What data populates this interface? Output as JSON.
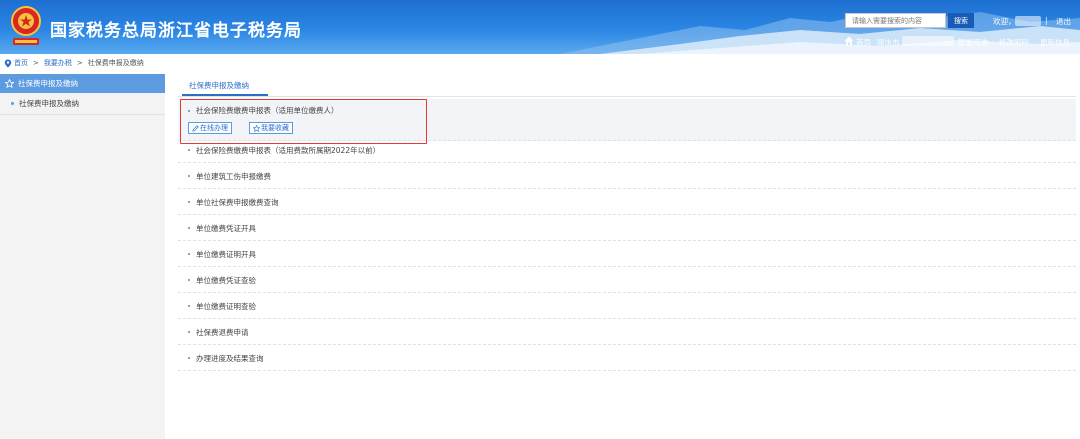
{
  "header": {
    "site_title": "国家税务总局浙江省电子税务局",
    "search": {
      "placeholder": "请输入需要搜索的内容",
      "button_label": "搜索"
    },
    "welcome": "欢迎，",
    "separator": "|",
    "logout": "退出",
    "home": "首页",
    "city": "丽水市",
    "links": [
      "智能咨询",
      "修改密码",
      "更新信息"
    ]
  },
  "breadcrumb": {
    "items": [
      "首页",
      "我要办税",
      "社保费申报及缴纳"
    ],
    "arrow": ">"
  },
  "sidebar": {
    "header": "社保费申报及缴纳",
    "items": [
      {
        "label": "社保费申报及缴纳"
      }
    ]
  },
  "main": {
    "tab_label": "社保费申报及缴纳",
    "expanded": {
      "title": "社会保险费缴费申报表（适用单位缴费人）",
      "online_button": "在线办理",
      "favorite_button": "我要收藏"
    },
    "rows": [
      "社会保险费缴费申报表（适用费款所属期2022年以前）",
      "单位建筑工伤申报缴费",
      "单位社保费申报缴费查询",
      "单位缴费凭证开具",
      "单位缴费证明开具",
      "单位缴费凭证查验",
      "单位缴费证明查验",
      "社保费退费申请",
      "办理进度及结果查询"
    ]
  },
  "colors": {
    "header_blue": "#2a86e4",
    "link_blue": "#2c6fc9",
    "sidebar_header": "#5c9be0",
    "highlight_red": "#e53935"
  }
}
